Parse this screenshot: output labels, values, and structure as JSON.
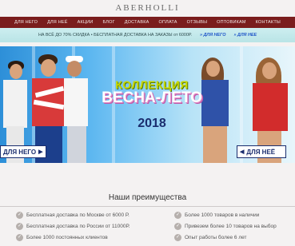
{
  "logo": "ABERHOLLI",
  "nav": {
    "items": [
      "ДЛЯ НЕГО",
      "ДЛЯ НЕЁ",
      "АКЦИИ",
      "БЛОГ",
      "ДОСТАВКА",
      "ОПЛАТА",
      "ОТЗЫВЫ",
      "ОПТОВИКАМ",
      "КОНТАКТЫ"
    ]
  },
  "promo": {
    "text": "НА ВСЁ ДО 70% СКИДКА • БЕСПЛАТНАЯ ДОСТАВКА НА ЗАКАЗЫ от 6000Р.",
    "link_him": "» ДЛЯ НЕГО",
    "link_her": "» ДЛЯ НЕЕ"
  },
  "hero": {
    "line1": "КОЛЛЕКЦИЯ",
    "line2": "ВЕСНА-ЛЕТО",
    "year": "2018",
    "btn_him": "ДЛЯ НЕГО",
    "btn_her": "ДЛЯ НЕЁ"
  },
  "advantages": {
    "title": "Наши преимущества",
    "left": [
      "Бесплатная доставка по Москве от 6000 Р.",
      "Бесплатная доставка по России от 11000Р.",
      "Более 1000 постоянных клиентов"
    ],
    "right": [
      "Более 1000 товаров в наличии",
      "Привезем более 10 товаров на выбор",
      "Опыт работы более 6 лет"
    ]
  },
  "colors": {
    "nav_bg": "#7a1d1d",
    "promo_bg": "#cdeef0",
    "accent_blue": "#1f55c8",
    "dark_navy": "#1a2d6e"
  }
}
